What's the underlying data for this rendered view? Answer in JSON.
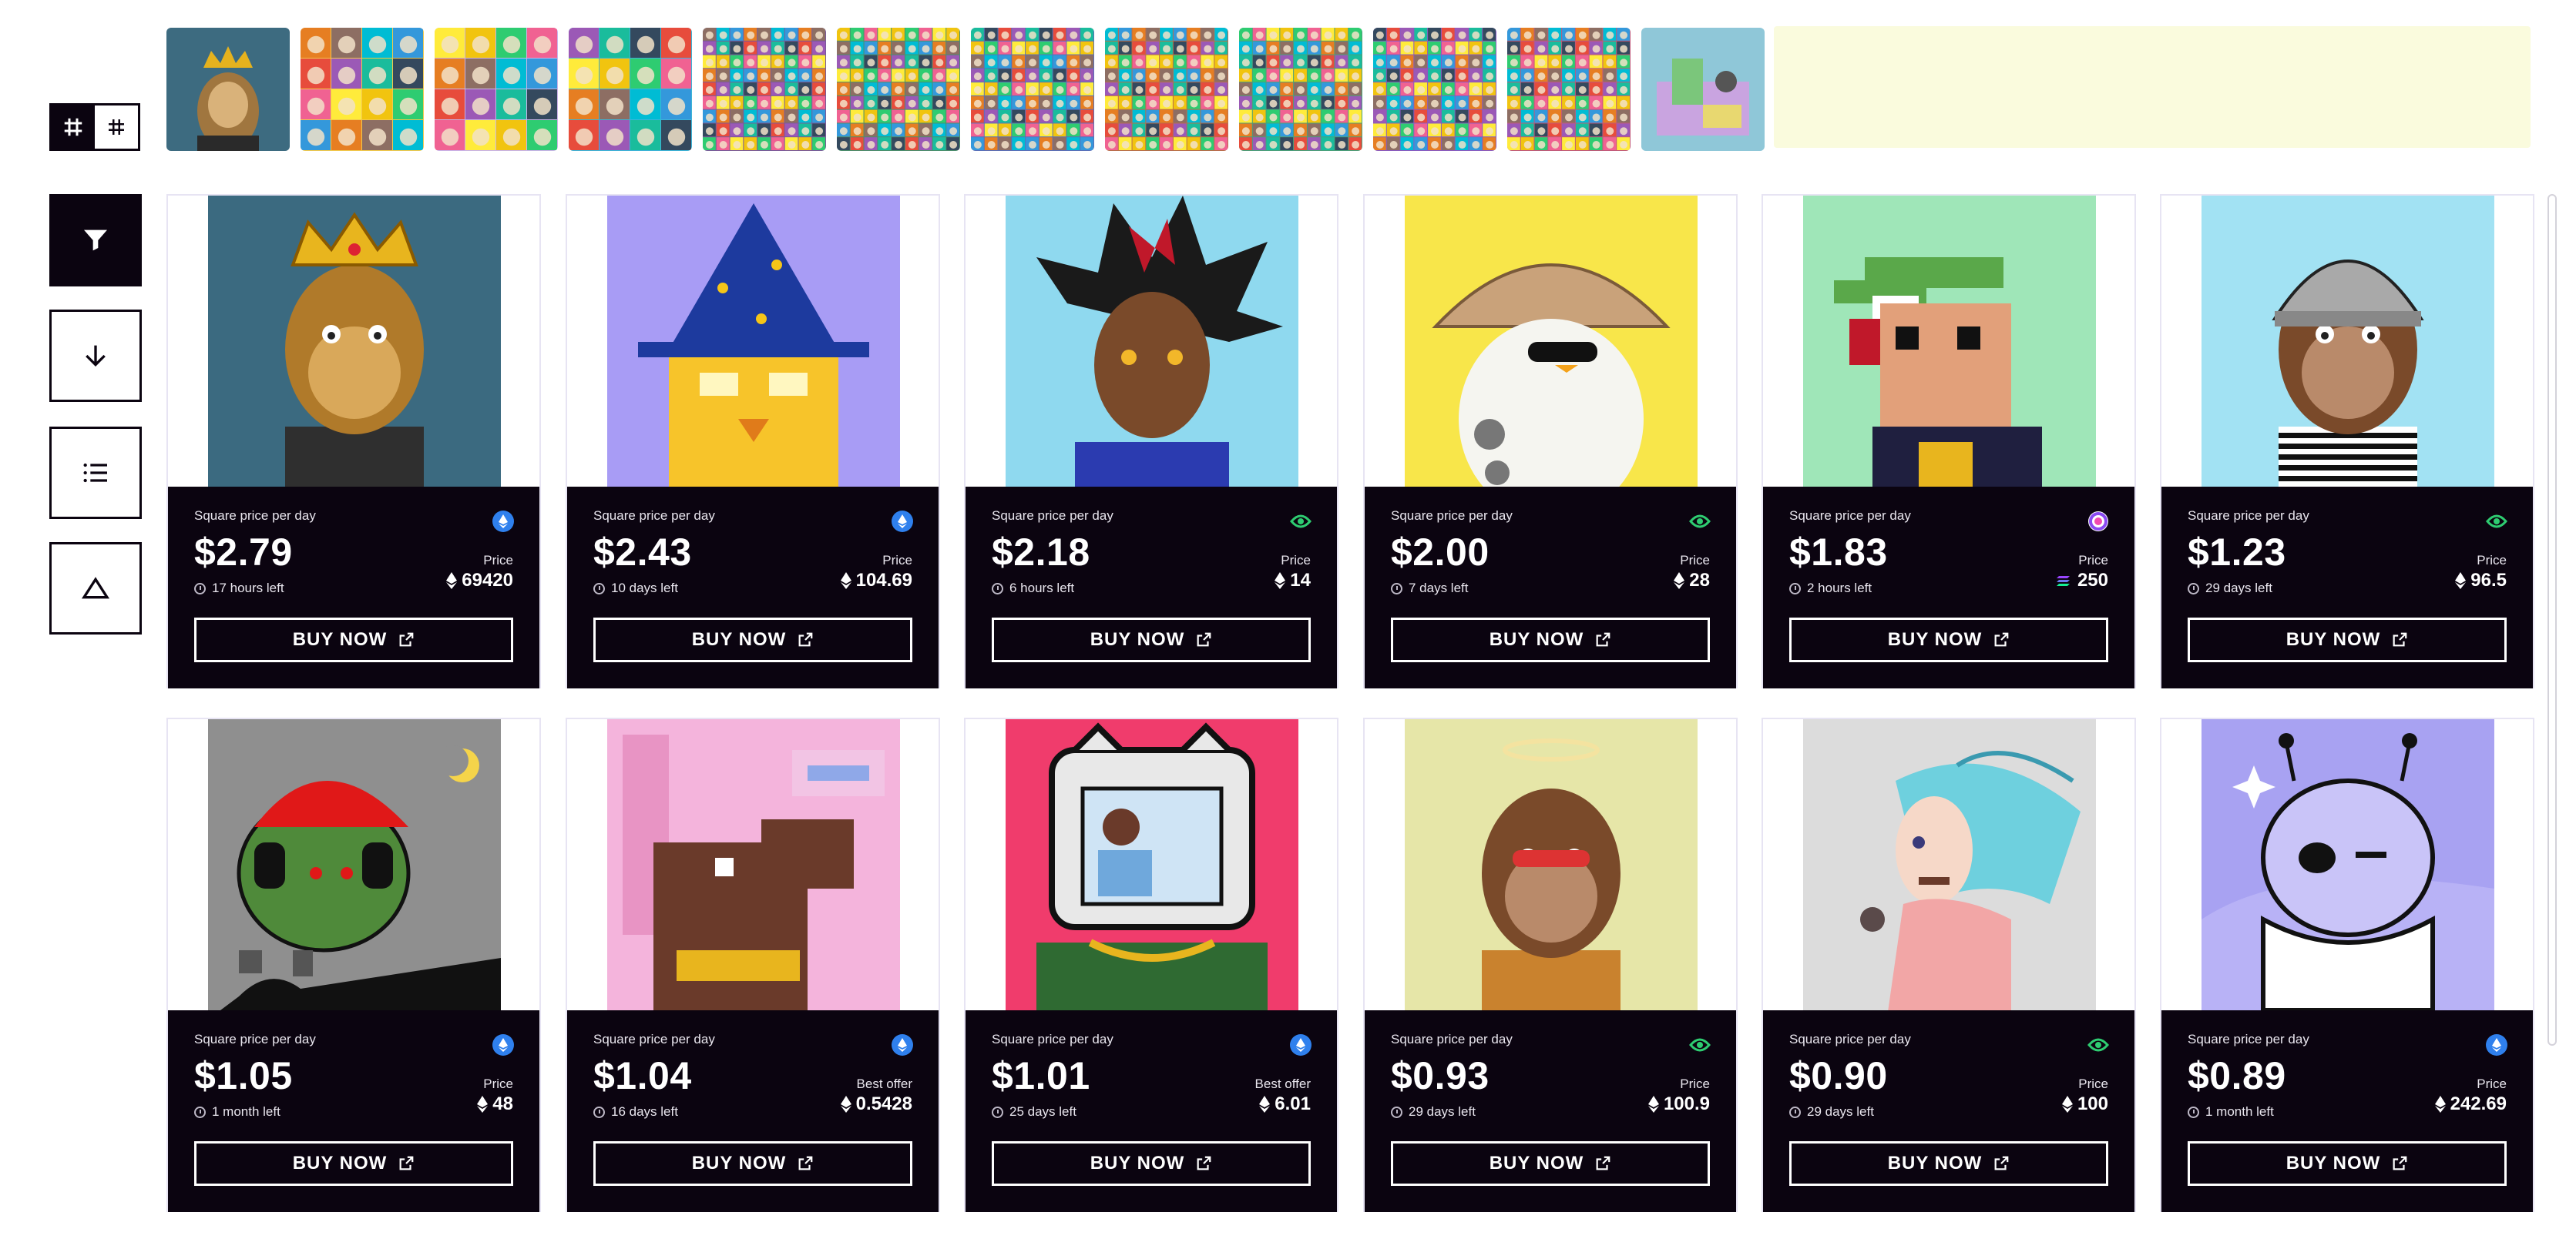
{
  "view_toggle": {
    "grid_large_icon": "grid-large-icon",
    "grid_small_icon": "grid-small-icon"
  },
  "toolbar": {
    "filter_icon": "filter-icon",
    "sort_icon": "arrow-down-icon",
    "list_icon": "list-icon",
    "triangle_icon": "triangle-icon"
  },
  "thumbnails": [
    {
      "name": "king-ape",
      "bg": "#3d6b80"
    },
    {
      "name": "doodle-collage",
      "bg": "#f2c94c"
    },
    {
      "name": "pastel-collage",
      "bg": "#c9b3e8"
    },
    {
      "name": "colorful-collage",
      "bg": "#3cb4d8"
    },
    {
      "name": "mosaic-1",
      "bg": "#7a5a9a"
    },
    {
      "name": "mosaic-2",
      "bg": "#4b8f6c"
    },
    {
      "name": "mosaic-3",
      "bg": "#5a6fb8"
    },
    {
      "name": "mosaic-4",
      "bg": "#b86e4b"
    },
    {
      "name": "mosaic-5",
      "bg": "#4aa07a"
    },
    {
      "name": "mosaic-6",
      "bg": "#8a5ac0"
    },
    {
      "name": "mosaic-7",
      "bg": "#c0597a"
    },
    {
      "name": "room-scene",
      "bg": "#8fc7d8"
    }
  ],
  "cards": [
    {
      "label": "Square price per day",
      "amount": "$2.79",
      "time": "17 hours left",
      "price_label": "Price",
      "price": "69420",
      "chain": "eth",
      "currency": "eth",
      "buy": "BUY NOW",
      "bg": "#3b6a80",
      "art": "ape-king"
    },
    {
      "label": "Square price per day",
      "amount": "$2.43",
      "time": "10 days left",
      "price_label": "Price",
      "price": "104.69",
      "chain": "eth",
      "currency": "eth",
      "buy": "BUY NOW",
      "bg": "#a89cf5",
      "art": "owl-wizard"
    },
    {
      "label": "Square price per day",
      "amount": "$2.18",
      "time": "6 hours left",
      "price_label": "Price",
      "price": "14",
      "chain": "green",
      "currency": "eth",
      "buy": "BUY NOW",
      "bg": "#8fd9ef",
      "art": "anime-boy"
    },
    {
      "label": "Square price per day",
      "amount": "$2.00",
      "time": "7 days left",
      "price_label": "Price",
      "price": "28",
      "chain": "green",
      "currency": "eth",
      "buy": "BUY NOW",
      "bg": "#f8e64a",
      "art": "penguin"
    },
    {
      "label": "Square price per day",
      "amount": "$1.83",
      "time": "2 hours left",
      "price_label": "Price",
      "price": "250",
      "chain": "rainbow",
      "currency": "sol",
      "buy": "BUY NOW",
      "bg": "#9fe6b8",
      "art": "pixel-punk"
    },
    {
      "label": "Square price per day",
      "amount": "$1.23",
      "time": "29 days left",
      "price_label": "Price",
      "price": "96.5",
      "chain": "green",
      "currency": "eth",
      "buy": "BUY NOW",
      "bg": "#a2e2f3",
      "art": "ape-helmet"
    },
    {
      "label": "Square price per day",
      "amount": "$1.05",
      "time": "1 month left",
      "price_label": "Price",
      "price": "48",
      "chain": "eth",
      "currency": "eth",
      "buy": "BUY NOW",
      "bg": "#8f8f8f",
      "art": "zombie-frog"
    },
    {
      "label": "Square price per day",
      "amount": "$1.04",
      "time": "16 days left",
      "price_label": "Best offer",
      "price": "0.5428",
      "chain": "eth",
      "currency": "eth",
      "buy": "BUY NOW",
      "bg": "#f4b4dc",
      "art": "pixel-dino"
    },
    {
      "label": "Square price per day",
      "amount": "$1.01",
      "time": "25 days left",
      "price_label": "Best offer",
      "price": "6.01",
      "chain": "eth",
      "currency": "eth",
      "buy": "BUY NOW",
      "bg": "#f03c6c",
      "art": "tv-head"
    },
    {
      "label": "Square price per day",
      "amount": "$0.93",
      "time": "29 days left",
      "price_label": "Price",
      "price": "100.9",
      "chain": "green",
      "currency": "eth",
      "buy": "BUY NOW",
      "bg": "#e6e6a8",
      "art": "ape-halo"
    },
    {
      "label": "Square price per day",
      "amount": "$0.90",
      "time": "29 days left",
      "price_label": "Price",
      "price": "100",
      "chain": "green",
      "currency": "eth",
      "buy": "BUY NOW",
      "bg": "#dcdcdc",
      "art": "anime-girl"
    },
    {
      "label": "Square price per day",
      "amount": "$0.89",
      "time": "1 month left",
      "price_label": "Price",
      "price": "242.69",
      "chain": "eth",
      "currency": "eth",
      "buy": "BUY NOW",
      "bg": "#a8a2f2",
      "art": "alien"
    }
  ],
  "colors": {
    "panel": "#0b0410",
    "accent_blue": "#2f80ed",
    "accent_green": "#2ecc71",
    "strip_filler": "#fafbdd"
  }
}
